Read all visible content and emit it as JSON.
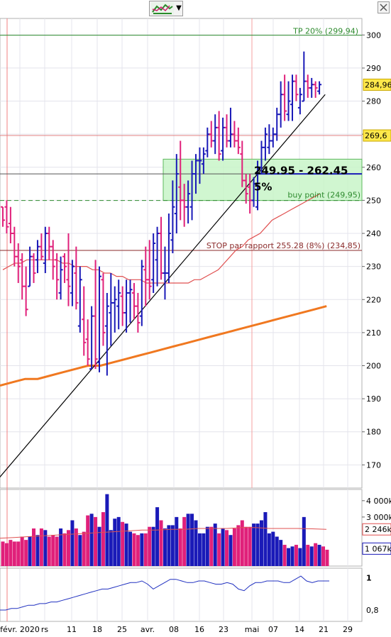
{
  "toolbar": {
    "icon": "chart-indicator-icon",
    "dropdown_label": "▼"
  },
  "corner_icon": "close-icon",
  "chart_data": [
    {
      "type": "ohlc",
      "y_axis_ticks": [
        170,
        180,
        190,
        200,
        210,
        220,
        230,
        240,
        250,
        260,
        270,
        280,
        290,
        300
      ],
      "ylim": [
        163,
        305
      ],
      "x_axis_labels": [
        "févr. 2020",
        "rs",
        "11",
        "18",
        "25",
        "avr.",
        "08",
        "16",
        "23",
        "mai",
        "07",
        "14",
        "21",
        "29"
      ],
      "price_tags": {
        "last": "284,96",
        "resistance": "269,6"
      },
      "levels": {
        "tp": {
          "label": "TP 20% (299,94)",
          "value": 299.94,
          "color": "#2e8b2e"
        },
        "buy": {
          "label": "buy point (249,95)",
          "value": 249.95,
          "color": "#2e8b2e"
        },
        "stop": {
          "label": "STOP par rapport 255.28 (8%) (234,85)",
          "value": 234.85,
          "color": "#8a2a2a"
        },
        "resistance": {
          "value": 269.6,
          "color": "#e08080"
        },
        "pivot": {
          "value": 258.0,
          "color": "#000000"
        }
      },
      "buy_zone": {
        "low": 249.95,
        "high": 262.45,
        "label": "249.95 - 262.45",
        "pct": "5%"
      },
      "colors": {
        "up": "#1a1ab8",
        "down": "#e0207a",
        "ma_short": "#e05050",
        "ma_long": "#f07820",
        "trendline": "#000000"
      },
      "bars": [
        {
          "o": 248,
          "h": 248,
          "l": 242,
          "c": 244
        },
        {
          "o": 248,
          "h": 250,
          "l": 240,
          "c": 242
        },
        {
          "o": 243,
          "h": 248,
          "l": 237,
          "c": 240
        },
        {
          "o": 240,
          "h": 242,
          "l": 230,
          "c": 233
        },
        {
          "o": 233,
          "h": 237,
          "l": 225,
          "c": 230
        },
        {
          "o": 232,
          "h": 234,
          "l": 220,
          "c": 224
        },
        {
          "o": 224,
          "h": 230,
          "l": 215,
          "c": 217
        },
        {
          "o": 224,
          "h": 236,
          "l": 224,
          "c": 233
        },
        {
          "o": 233,
          "h": 234,
          "l": 225,
          "c": 228
        },
        {
          "o": 232,
          "h": 238,
          "l": 228,
          "c": 236
        },
        {
          "o": 236,
          "h": 240,
          "l": 232,
          "c": 233
        },
        {
          "o": 231,
          "h": 242,
          "l": 228,
          "c": 240
        },
        {
          "o": 240,
          "h": 242,
          "l": 232,
          "c": 236
        },
        {
          "o": 236,
          "h": 238,
          "l": 226,
          "c": 230
        },
        {
          "o": 232,
          "h": 234,
          "l": 220,
          "c": 226
        },
        {
          "o": 222,
          "h": 233,
          "l": 220,
          "c": 229
        },
        {
          "o": 233,
          "h": 234,
          "l": 225,
          "c": 230
        },
        {
          "o": 226,
          "h": 240,
          "l": 218,
          "c": 224
        },
        {
          "o": 222,
          "h": 232,
          "l": 218,
          "c": 230
        },
        {
          "o": 228,
          "h": 236,
          "l": 217,
          "c": 219
        },
        {
          "o": 212,
          "h": 230,
          "l": 210,
          "c": 226
        },
        {
          "o": 214,
          "h": 224,
          "l": 203,
          "c": 207
        },
        {
          "o": 208,
          "h": 214,
          "l": 200,
          "c": 202
        },
        {
          "o": 199,
          "h": 218,
          "l": 199,
          "c": 215
        },
        {
          "o": 215,
          "h": 232,
          "l": 199,
          "c": 202
        },
        {
          "o": 201,
          "h": 230,
          "l": 198,
          "c": 227
        },
        {
          "o": 226,
          "h": 228,
          "l": 206,
          "c": 210
        },
        {
          "o": 212,
          "h": 222,
          "l": 197,
          "c": 218
        },
        {
          "o": 216,
          "h": 228,
          "l": 206,
          "c": 219
        },
        {
          "o": 219,
          "h": 224,
          "l": 210,
          "c": 220
        },
        {
          "o": 218,
          "h": 226,
          "l": 211,
          "c": 222
        },
        {
          "o": 221,
          "h": 224,
          "l": 212,
          "c": 216
        },
        {
          "o": 216,
          "h": 226,
          "l": 210,
          "c": 222
        },
        {
          "o": 222,
          "h": 226,
          "l": 213,
          "c": 223
        },
        {
          "o": 222,
          "h": 225,
          "l": 214,
          "c": 218
        },
        {
          "o": 218,
          "h": 222,
          "l": 210,
          "c": 213
        },
        {
          "o": 215,
          "h": 232,
          "l": 212,
          "c": 230
        },
        {
          "o": 229,
          "h": 236,
          "l": 218,
          "c": 226
        },
        {
          "o": 226,
          "h": 238,
          "l": 220,
          "c": 224
        },
        {
          "o": 226,
          "h": 240,
          "l": 222,
          "c": 237
        },
        {
          "o": 232,
          "h": 242,
          "l": 224,
          "c": 240
        },
        {
          "o": 240,
          "h": 245,
          "l": 226,
          "c": 228
        },
        {
          "o": 228,
          "h": 236,
          "l": 220,
          "c": 228
        },
        {
          "o": 228,
          "h": 246,
          "l": 225,
          "c": 240
        },
        {
          "o": 238,
          "h": 256,
          "l": 234,
          "c": 248
        },
        {
          "o": 246,
          "h": 264,
          "l": 240,
          "c": 258
        },
        {
          "o": 254,
          "h": 268,
          "l": 244,
          "c": 250
        },
        {
          "o": 250,
          "h": 255,
          "l": 242,
          "c": 248
        },
        {
          "o": 248,
          "h": 256,
          "l": 243,
          "c": 252
        },
        {
          "o": 248,
          "h": 262,
          "l": 244,
          "c": 258
        },
        {
          "o": 258,
          "h": 264,
          "l": 252,
          "c": 262
        },
        {
          "o": 262,
          "h": 266,
          "l": 255,
          "c": 262
        },
        {
          "o": 261,
          "h": 266,
          "l": 258,
          "c": 264
        },
        {
          "o": 265,
          "h": 272,
          "l": 263,
          "c": 270
        },
        {
          "o": 270,
          "h": 274,
          "l": 266,
          "c": 268
        },
        {
          "o": 268,
          "h": 276,
          "l": 264,
          "c": 272
        },
        {
          "o": 272,
          "h": 277,
          "l": 262,
          "c": 264
        },
        {
          "o": 265,
          "h": 275,
          "l": 262,
          "c": 272
        },
        {
          "o": 272,
          "h": 276,
          "l": 266,
          "c": 268
        },
        {
          "o": 268,
          "h": 278,
          "l": 266,
          "c": 270
        },
        {
          "o": 270,
          "h": 274,
          "l": 266,
          "c": 268
        },
        {
          "o": 268,
          "h": 272,
          "l": 264,
          "c": 266
        },
        {
          "o": 264,
          "h": 268,
          "l": 254,
          "c": 256
        },
        {
          "o": 256,
          "h": 258,
          "l": 249,
          "c": 252
        },
        {
          "o": 254,
          "h": 258,
          "l": 246,
          "c": 250
        },
        {
          "o": 250,
          "h": 257,
          "l": 248,
          "c": 255
        },
        {
          "o": 248,
          "h": 262,
          "l": 247,
          "c": 260
        },
        {
          "o": 260,
          "h": 268,
          "l": 258,
          "c": 266
        },
        {
          "o": 266,
          "h": 272,
          "l": 262,
          "c": 270
        },
        {
          "o": 266,
          "h": 273,
          "l": 264,
          "c": 268
        },
        {
          "o": 268,
          "h": 272,
          "l": 266,
          "c": 270
        },
        {
          "o": 270,
          "h": 278,
          "l": 268,
          "c": 276
        },
        {
          "o": 276,
          "h": 286,
          "l": 272,
          "c": 282
        },
        {
          "o": 282,
          "h": 288,
          "l": 274,
          "c": 277
        },
        {
          "o": 276,
          "h": 286,
          "l": 274,
          "c": 280
        },
        {
          "o": 279,
          "h": 288,
          "l": 274,
          "c": 286
        },
        {
          "o": 286,
          "h": 288,
          "l": 280,
          "c": 282
        },
        {
          "o": 278,
          "h": 284,
          "l": 276,
          "c": 282
        },
        {
          "o": 280,
          "h": 295,
          "l": 280,
          "c": 286
        },
        {
          "o": 286,
          "h": 288,
          "l": 281,
          "c": 284
        },
        {
          "o": 284,
          "h": 287,
          "l": 281,
          "c": 285
        },
        {
          "o": 285,
          "h": 286,
          "l": 281,
          "c": 284
        },
        {
          "o": 283,
          "h": 286,
          "l": 282,
          "c": 285
        }
      ],
      "ma_short": [
        229,
        230,
        231,
        231,
        232,
        232,
        232,
        232,
        232,
        232,
        231,
        231,
        230,
        230,
        230,
        229,
        229,
        228,
        228,
        227,
        227,
        226,
        226,
        226,
        225,
        225,
        225,
        225,
        225,
        225,
        225,
        225,
        226,
        226,
        227,
        228,
        229,
        231,
        233,
        235,
        236,
        238,
        239,
        240,
        242,
        244,
        245,
        246,
        247,
        248,
        249,
        250,
        251,
        252
      ],
      "ma_long": [
        194,
        195,
        196,
        196,
        197,
        198,
        199,
        200,
        200,
        201,
        202,
        203,
        204,
        205,
        206,
        207,
        208,
        209,
        210,
        211,
        212,
        213,
        214,
        215,
        216,
        217,
        218
      ],
      "trendline": {
        "x0": -1,
        "y0": 166,
        "x1": 83.5,
        "y1": 282
      }
    },
    {
      "type": "bar",
      "name": "volume",
      "y_axis_ticks": [
        "4 000k",
        "3 000k",
        "1 067k"
      ],
      "tags": {
        "average": "2 246k",
        "last": "1 067k"
      },
      "values": [
        1500,
        1400,
        1600,
        1500,
        1500,
        1800,
        1600,
        1800,
        2300,
        1900,
        2300,
        2200,
        1800,
        1900,
        1800,
        2300,
        2000,
        2200,
        2800,
        2300,
        1900,
        2100,
        3100,
        3200,
        3000,
        2400,
        3300,
        4400,
        2200,
        2900,
        3000,
        2700,
        2600,
        2100,
        2000,
        1900,
        2000,
        2000,
        2400,
        2400,
        3600,
        2800,
        2300,
        2500,
        2500,
        3000,
        2300,
        3000,
        3200,
        3200,
        2800,
        2000,
        2000,
        2400,
        2400,
        2600,
        2000,
        2300,
        2200,
        1900,
        2300,
        2500,
        2800,
        2400,
        2400,
        2600,
        2600,
        2800,
        3300,
        2000,
        2100,
        1800,
        1600,
        1300,
        1100,
        1200,
        1300,
        1100,
        3000,
        1300,
        1200,
        1400,
        1300,
        1200,
        1000
      ],
      "ma": [
        1700,
        1750,
        1800,
        1850,
        1900,
        1950,
        2000,
        2050,
        2100,
        2150,
        2200,
        2200,
        2250,
        2250,
        2300,
        2300,
        2300,
        2350,
        2350,
        2300,
        2300,
        2300,
        2280,
        2250
      ],
      "ylim": [
        0,
        4600
      ]
    },
    {
      "type": "line",
      "name": "oscillator",
      "y_axis_ticks": [
        "1",
        "0,8"
      ],
      "values": [
        0.8,
        0.8,
        0.81,
        0.81,
        0.82,
        0.83,
        0.83,
        0.84,
        0.84,
        0.85,
        0.85,
        0.86,
        0.87,
        0.88,
        0.89,
        0.9,
        0.91,
        0.92,
        0.93,
        0.93,
        0.94,
        0.95,
        0.96,
        0.97,
        0.97,
        0.98,
        0.96,
        0.93,
        0.95,
        0.97,
        0.99,
        0.99,
        0.98,
        0.97,
        0.97,
        0.98,
        0.98,
        0.97,
        0.96,
        0.96,
        0.97,
        0.96,
        0.93,
        0.92,
        0.95,
        0.97,
        0.97,
        0.98,
        0.98,
        0.98,
        0.97,
        0.97,
        0.99,
        1.01,
        0.98,
        0.97,
        0.98,
        0.98,
        0.98
      ],
      "ylim": [
        0.73,
        1.05
      ]
    }
  ]
}
